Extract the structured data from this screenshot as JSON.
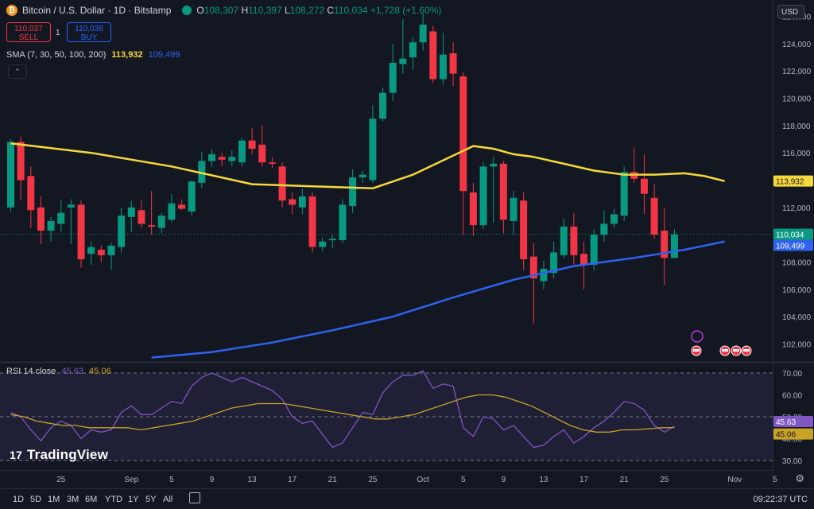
{
  "header": {
    "symbol_title": "Bitcoin / U.S. Dollar · 1D · Bitstamp",
    "ohlc": {
      "o_label": "O",
      "o": "108,307",
      "h_label": "H",
      "h": "110,397",
      "l_label": "L",
      "l": "108,272",
      "c_label": "C",
      "c": "110,034",
      "change": "+1,728 (+1.60%)"
    },
    "sell": {
      "price": "110,037",
      "label": "SELL"
    },
    "buy": {
      "price": "110,038",
      "label": "BUY"
    },
    "quantity": "1",
    "currency": "USD"
  },
  "sma": {
    "label": "SMA (7, 30, 50, 100, 200)",
    "value1": "113,932",
    "value2": "109,499"
  },
  "rsi": {
    "label": "RSI 14 close",
    "value1": "45.63",
    "value2": "45.06"
  },
  "branding": {
    "logo_text": "TradingView",
    "logo_mark": "17"
  },
  "bottom": {
    "ranges": [
      "1D",
      "5D",
      "1M",
      "3M",
      "6M",
      "YTD",
      "1Y",
      "5Y",
      "All"
    ],
    "clock": "09:22:37 UTC"
  },
  "colors": {
    "up": "#089981",
    "down": "#f23645",
    "sma_short": "#f7d83a",
    "sma_long": "#2f62f0",
    "rsi": "#7e57c2",
    "rsi_ma": "#c9a227"
  },
  "chart_data": {
    "type": "candlestick",
    "price_axis": {
      "ylim": [
        100800,
        127200
      ],
      "ticks": [
        102000,
        104000,
        106000,
        108000,
        110000,
        112000,
        114000,
        116000,
        118000,
        120000,
        122000,
        124000,
        126000
      ],
      "tick_labels": [
        "102,000",
        "104,000",
        "106,000",
        "108,000",
        "110,000",
        "112,000",
        "114,000",
        "116,000",
        "118,000",
        "120,000",
        "122,000",
        "124,000",
        "126,000"
      ]
    },
    "x_axis": {
      "ticks": [
        {
          "day": 5,
          "label": "25"
        },
        {
          "day": 12,
          "label": "Sep"
        },
        {
          "day": 16,
          "label": "5"
        },
        {
          "day": 20,
          "label": "9"
        },
        {
          "day": 24,
          "label": "13"
        },
        {
          "day": 28,
          "label": "17"
        },
        {
          "day": 32,
          "label": "21"
        },
        {
          "day": 36,
          "label": "25"
        },
        {
          "day": 41,
          "label": "Oct"
        },
        {
          "day": 45,
          "label": "5"
        },
        {
          "day": 49,
          "label": "9"
        },
        {
          "day": 53,
          "label": "13"
        },
        {
          "day": 57,
          "label": "17"
        },
        {
          "day": 61,
          "label": "21"
        },
        {
          "day": 65,
          "label": "25"
        },
        {
          "day": 72,
          "label": "Nov"
        },
        {
          "day": 76,
          "label": "5"
        }
      ]
    },
    "candles": [
      {
        "o": 112000,
        "h": 117000,
        "l": 111700,
        "c": 116800
      },
      {
        "o": 116800,
        "h": 117200,
        "l": 112500,
        "c": 114000
      },
      {
        "o": 114300,
        "h": 115000,
        "l": 110500,
        "c": 111800
      },
      {
        "o": 112000,
        "h": 112800,
        "l": 109300,
        "c": 110300
      },
      {
        "o": 110300,
        "h": 111300,
        "l": 109500,
        "c": 111000
      },
      {
        "o": 110800,
        "h": 112500,
        "l": 110200,
        "c": 111600
      },
      {
        "o": 112000,
        "h": 112600,
        "l": 109300,
        "c": 112200
      },
      {
        "o": 112200,
        "h": 112500,
        "l": 107600,
        "c": 108200
      },
      {
        "o": 108600,
        "h": 109500,
        "l": 107800,
        "c": 109100
      },
      {
        "o": 108900,
        "h": 109200,
        "l": 108000,
        "c": 108500
      },
      {
        "o": 108500,
        "h": 109400,
        "l": 107400,
        "c": 109200
      },
      {
        "o": 109100,
        "h": 112000,
        "l": 108700,
        "c": 111400
      },
      {
        "o": 111300,
        "h": 112500,
        "l": 110200,
        "c": 112000
      },
      {
        "o": 111800,
        "h": 112500,
        "l": 110500,
        "c": 110800
      },
      {
        "o": 110700,
        "h": 113200,
        "l": 110000,
        "c": 110600
      },
      {
        "o": 110500,
        "h": 111600,
        "l": 110100,
        "c": 111400
      },
      {
        "o": 111100,
        "h": 113000,
        "l": 110900,
        "c": 112300
      },
      {
        "o": 112200,
        "h": 112600,
        "l": 111800,
        "c": 111900
      },
      {
        "o": 111700,
        "h": 114000,
        "l": 111400,
        "c": 113900
      },
      {
        "o": 113800,
        "h": 116100,
        "l": 113400,
        "c": 115400
      },
      {
        "o": 115400,
        "h": 116300,
        "l": 115000,
        "c": 115900
      },
      {
        "o": 115700,
        "h": 116000,
        "l": 115000,
        "c": 115500
      },
      {
        "o": 115400,
        "h": 116200,
        "l": 115000,
        "c": 115700
      },
      {
        "o": 115300,
        "h": 117100,
        "l": 115000,
        "c": 116900
      },
      {
        "o": 116900,
        "h": 117800,
        "l": 115900,
        "c": 116300
      },
      {
        "o": 116600,
        "h": 118000,
        "l": 115000,
        "c": 115300
      },
      {
        "o": 115300,
        "h": 115700,
        "l": 114900,
        "c": 115200
      },
      {
        "o": 115000,
        "h": 115300,
        "l": 112000,
        "c": 112500
      },
      {
        "o": 112600,
        "h": 113100,
        "l": 111500,
        "c": 112200
      },
      {
        "o": 112000,
        "h": 113400,
        "l": 111500,
        "c": 112800
      },
      {
        "o": 112800,
        "h": 113100,
        "l": 108700,
        "c": 109100
      },
      {
        "o": 109100,
        "h": 109800,
        "l": 108800,
        "c": 109500
      },
      {
        "o": 109600,
        "h": 110000,
        "l": 109000,
        "c": 109700
      },
      {
        "o": 109600,
        "h": 112600,
        "l": 109400,
        "c": 112200
      },
      {
        "o": 112100,
        "h": 114800,
        "l": 111600,
        "c": 114200
      },
      {
        "o": 114200,
        "h": 114700,
        "l": 113800,
        "c": 114400
      },
      {
        "o": 114000,
        "h": 119500,
        "l": 113800,
        "c": 118500
      },
      {
        "o": 118500,
        "h": 120800,
        "l": 118300,
        "c": 120400
      },
      {
        "o": 120400,
        "h": 124000,
        "l": 119800,
        "c": 122600
      },
      {
        "o": 122500,
        "h": 125800,
        "l": 121800,
        "c": 122900
      },
      {
        "o": 123000,
        "h": 124500,
        "l": 122100,
        "c": 124100
      },
      {
        "o": 124100,
        "h": 126200,
        "l": 123500,
        "c": 125400
      },
      {
        "o": 124900,
        "h": 125300,
        "l": 121100,
        "c": 121400
      },
      {
        "o": 121400,
        "h": 124800,
        "l": 121000,
        "c": 123200
      },
      {
        "o": 123300,
        "h": 124100,
        "l": 120900,
        "c": 121800
      },
      {
        "o": 121600,
        "h": 121900,
        "l": 110000,
        "c": 113200
      },
      {
        "o": 113100,
        "h": 113800,
        "l": 109900,
        "c": 110700
      },
      {
        "o": 110700,
        "h": 115300,
        "l": 110400,
        "c": 115000
      },
      {
        "o": 115000,
        "h": 115700,
        "l": 110900,
        "c": 115200
      },
      {
        "o": 115200,
        "h": 115400,
        "l": 110100,
        "c": 111100
      },
      {
        "o": 111000,
        "h": 113200,
        "l": 110000,
        "c": 112700
      },
      {
        "o": 112500,
        "h": 113100,
        "l": 107400,
        "c": 108200
      },
      {
        "o": 108400,
        "h": 109400,
        "l": 103500,
        "c": 106800
      },
      {
        "o": 106600,
        "h": 108100,
        "l": 106000,
        "c": 107500
      },
      {
        "o": 107200,
        "h": 109500,
        "l": 106800,
        "c": 108700
      },
      {
        "o": 108500,
        "h": 111200,
        "l": 108300,
        "c": 110600
      },
      {
        "o": 110600,
        "h": 111600,
        "l": 107800,
        "c": 108500
      },
      {
        "o": 108600,
        "h": 109500,
        "l": 106000,
        "c": 107800
      },
      {
        "o": 107800,
        "h": 110400,
        "l": 107400,
        "c": 110000
      },
      {
        "o": 110000,
        "h": 111800,
        "l": 109500,
        "c": 110800
      },
      {
        "o": 110800,
        "h": 111900,
        "l": 110500,
        "c": 111500
      },
      {
        "o": 111400,
        "h": 115000,
        "l": 111000,
        "c": 114600
      },
      {
        "o": 114600,
        "h": 116400,
        "l": 113800,
        "c": 114100
      },
      {
        "o": 114100,
        "h": 115900,
        "l": 111500,
        "c": 113000
      },
      {
        "o": 112700,
        "h": 113700,
        "l": 109700,
        "c": 110000
      },
      {
        "o": 110300,
        "h": 112000,
        "l": 106300,
        "c": 108300
      },
      {
        "o": 108300,
        "h": 110400,
        "l": 108300,
        "c": 110034
      }
    ],
    "series": [
      {
        "name": "SMA 113,932",
        "color": "#f7d83a",
        "x": [
          0,
          8,
          16,
          24,
          28,
          32,
          36,
          40,
          44,
          46,
          48,
          50,
          52,
          55,
          58,
          61,
          64,
          67,
          69,
          71
        ],
        "y": [
          116700,
          116000,
          115000,
          113700,
          113600,
          113500,
          113400,
          114400,
          115800,
          116500,
          116300,
          115900,
          115700,
          115200,
          114700,
          114400,
          114400,
          114500,
          114300,
          113932
        ]
      },
      {
        "name": "SMA 109,499",
        "color": "#2f62f0",
        "x": [
          14,
          20,
          26,
          32,
          38,
          44,
          50,
          56,
          62,
          67,
          71
        ],
        "y": [
          101000,
          101400,
          102100,
          103000,
          104000,
          105400,
          106700,
          107700,
          108300,
          108900,
          109499
        ]
      }
    ],
    "price_labels": [
      {
        "value": 113932,
        "text": "113,932",
        "color": "#f7d83a"
      },
      {
        "value": 110034,
        "text": "110,034",
        "color": "#089981"
      },
      {
        "value": 109499,
        "text": "109,499",
        "color": "#2f62f0"
      }
    ],
    "rsi_panel": {
      "ylim": [
        26,
        74
      ],
      "ticks": [
        30,
        40,
        50,
        60,
        70
      ],
      "tick_labels": [
        "30.00",
        "40.00",
        "50.00",
        "60.00",
        "70.00"
      ],
      "rsi": [
        52,
        50,
        44,
        39,
        45,
        48,
        46,
        40,
        44,
        43,
        44,
        52,
        55,
        51,
        51,
        54,
        57,
        56,
        64,
        68,
        70,
        68,
        66,
        68,
        66,
        64,
        62,
        58,
        50,
        47,
        48,
        42,
        36,
        38,
        45,
        52,
        51,
        61,
        66,
        69,
        69,
        71,
        63,
        65,
        64,
        45,
        41,
        50,
        49,
        44,
        46,
        41,
        36,
        37,
        41,
        44,
        38,
        41,
        45,
        48,
        52,
        57,
        56,
        53,
        46,
        43,
        45.63
      ],
      "rsi_ma": [
        51,
        50,
        48,
        47,
        46,
        46,
        45,
        45,
        45,
        45,
        44,
        45,
        46,
        47,
        48,
        50,
        52,
        54,
        55,
        56,
        56,
        56,
        55,
        54,
        53,
        52,
        51,
        50,
        49,
        49,
        50,
        51,
        53,
        55,
        57,
        59,
        60,
        60,
        59,
        57,
        55,
        52,
        49,
        46,
        44,
        43,
        43,
        44,
        44,
        44.5,
        45,
        45.06
      ]
    },
    "rsi_values_labels": [
      {
        "text": "45.63",
        "color": "#7e57c2"
      },
      {
        "text": "45.06",
        "color": "#c9a227"
      }
    ]
  }
}
